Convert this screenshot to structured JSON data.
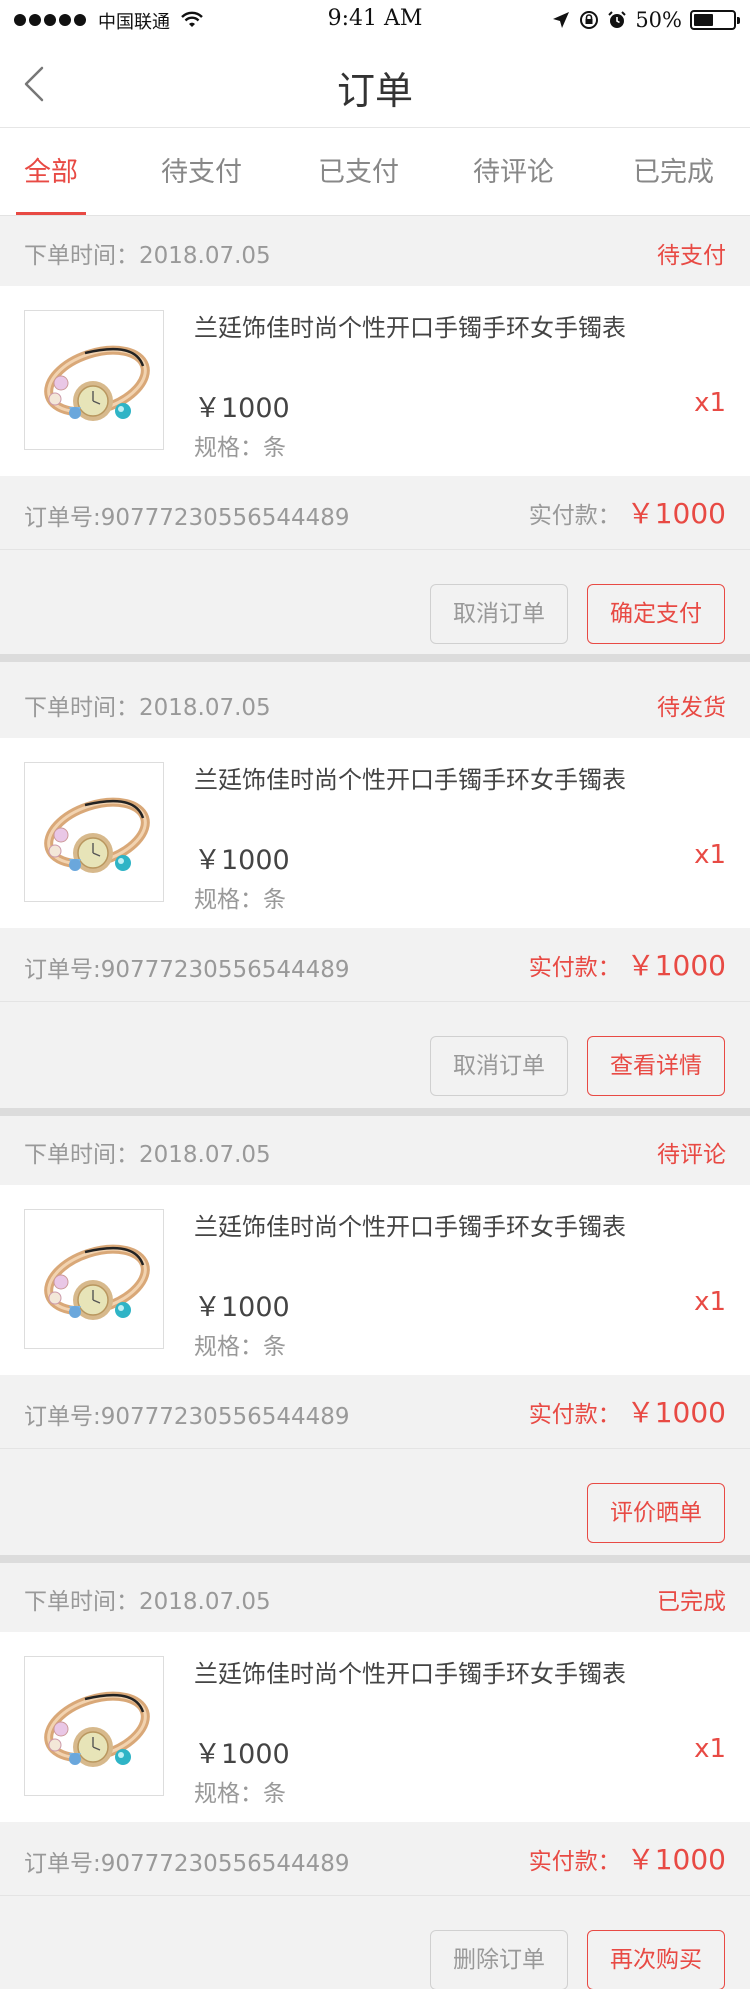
{
  "statusbar": {
    "carrier": "中国联通",
    "time": "9:41 AM",
    "battery_percent": "50%",
    "battery_level": 0.5,
    "icons": [
      "signal-dots-icon",
      "wifi-icon",
      "location-arrow-icon",
      "rotation-lock-icon",
      "alarm-icon",
      "battery-icon"
    ]
  },
  "nav": {
    "title": "订单",
    "back_icon": "chevron-left-icon"
  },
  "tabs": [
    {
      "label": "全部",
      "active": true
    },
    {
      "label": "待支付",
      "active": false
    },
    {
      "label": "已支付",
      "active": false
    },
    {
      "label": "待评论",
      "active": false
    },
    {
      "label": "已完成",
      "active": false
    }
  ],
  "colors": {
    "accent": "#e84a44",
    "background": "#f2f2f2",
    "muted_text": "#999999"
  },
  "orders": [
    {
      "time": "下单时间：2018.07.05",
      "status": "待支付",
      "product_name": "兰廷饰佳时尚个性开口手镯手环女手镯表",
      "price": "￥1000",
      "spec": "规格：条",
      "qty": "x1",
      "order_no": "订单号:90777230556544489",
      "paid_label": "实付款：",
      "paid_label_color": "#999999",
      "paid_amount": "￥1000",
      "buttons": [
        {
          "label": "取消订单",
          "style": "gray"
        },
        {
          "label": "确定支付",
          "style": "red"
        }
      ]
    },
    {
      "time": "下单时间：2018.07.05",
      "status": "待发货",
      "product_name": "兰廷饰佳时尚个性开口手镯手环女手镯表",
      "price": "￥1000",
      "spec": "规格：条",
      "qty": "x1",
      "order_no": "订单号:90777230556544489",
      "paid_label": "实付款：",
      "paid_label_color": "#e84a44",
      "paid_amount": "￥1000",
      "buttons": [
        {
          "label": "取消订单",
          "style": "gray"
        },
        {
          "label": "查看详情",
          "style": "red"
        }
      ]
    },
    {
      "time": "下单时间：2018.07.05",
      "status": "待评论",
      "product_name": "兰廷饰佳时尚个性开口手镯手环女手镯表",
      "price": "￥1000",
      "spec": "规格：条",
      "qty": "x1",
      "order_no": "订单号:90777230556544489",
      "paid_label": "实付款：",
      "paid_label_color": "#e84a44",
      "paid_amount": "￥1000",
      "buttons": [
        {
          "label": "评价晒单",
          "style": "red"
        }
      ]
    },
    {
      "time": "下单时间：2018.07.05",
      "status": "已完成",
      "product_name": "兰廷饰佳时尚个性开口手镯手环女手镯表",
      "price": "￥1000",
      "spec": "规格：条",
      "qty": "x1",
      "order_no": "订单号:90777230556544489",
      "paid_label": "实付款：",
      "paid_label_color": "#e84a44",
      "paid_amount": "￥1000",
      "buttons": [
        {
          "label": "删除订单",
          "style": "gray"
        },
        {
          "label": "再次购买",
          "style": "red"
        }
      ]
    }
  ]
}
